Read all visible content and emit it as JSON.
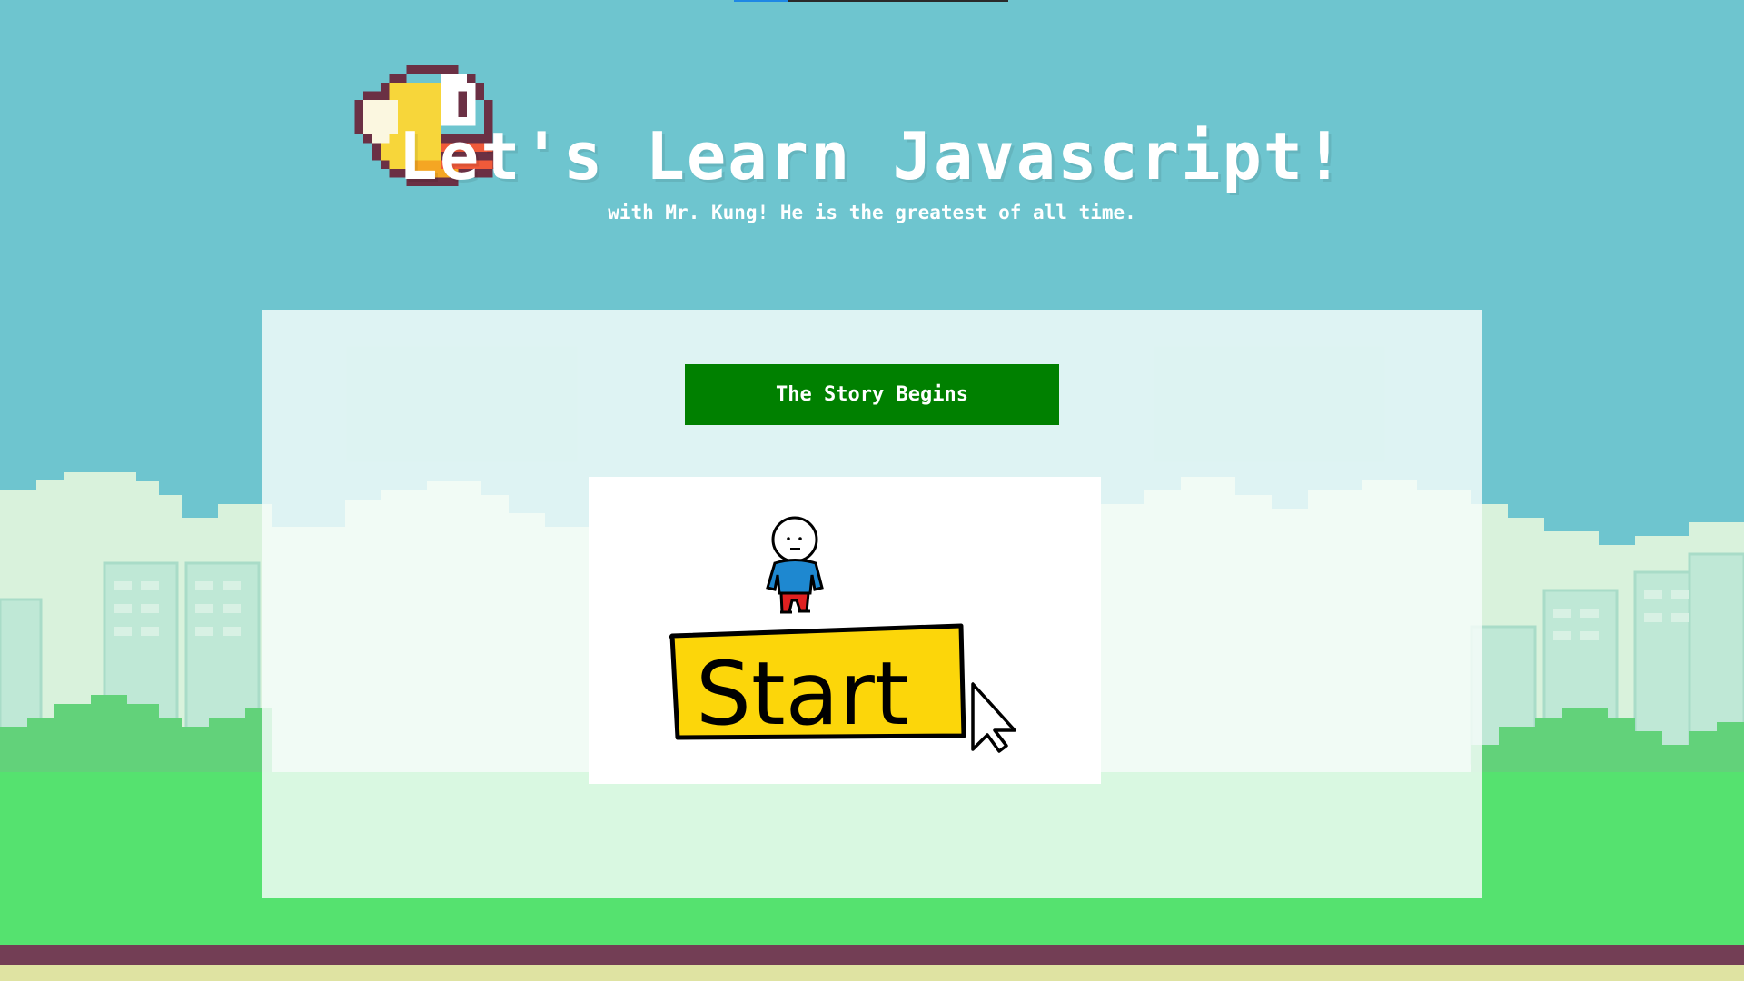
{
  "header": {
    "title": "Let's Learn Javascript!",
    "subtitle": "with Mr. Kung! He is the greatest of all time."
  },
  "top_progress": {
    "value_percent": 20
  },
  "story": {
    "button_label": "The Story Begins"
  },
  "comic": {
    "sign_text": "Start"
  },
  "icons": [
    "flappy-bird-icon",
    "mouse-cursor-icon"
  ],
  "colors": {
    "sky": "#6ec5cf",
    "grass": "#55e26f",
    "ground_stripe": "#733e55",
    "button_green": "#008000",
    "sign_yellow": "#fcd60a"
  }
}
